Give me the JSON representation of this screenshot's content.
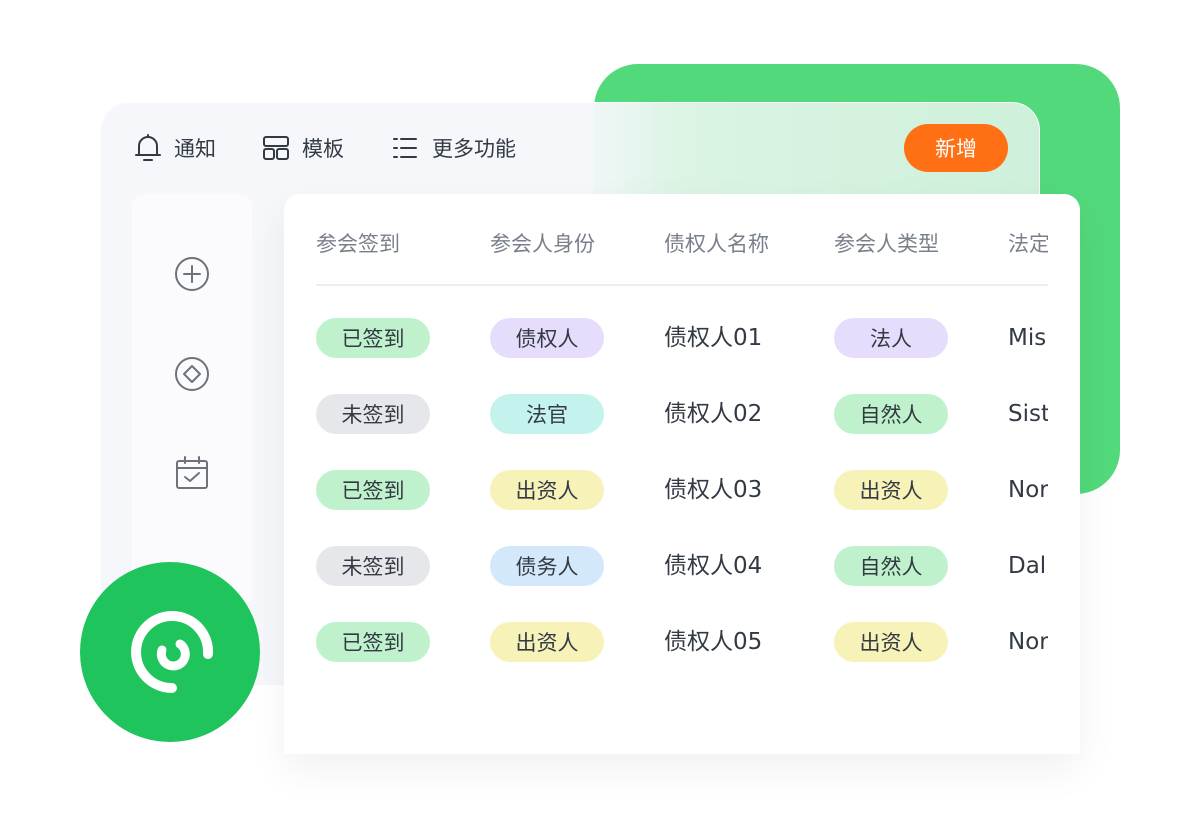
{
  "toolbar": {
    "notify_label": "通知",
    "template_label": "模板",
    "more_label": "更多功能",
    "add_label": "新增",
    "add_color": "#ff7015"
  },
  "sidebar": {
    "icons": [
      "plus-circle-icon",
      "diamond-icon",
      "calendar-check-icon"
    ]
  },
  "table": {
    "headers": [
      "参会签到",
      "参会人身份",
      "债权人名称",
      "参会人类型",
      "法定"
    ],
    "rows": [
      {
        "checkin": "已签到",
        "identity": "债权人",
        "name": "债权人01",
        "type": "法人",
        "legal": "Mis"
      },
      {
        "checkin": "未签到",
        "identity": "法官",
        "name": "债权人02",
        "type": "自然人",
        "legal": "Sist"
      },
      {
        "checkin": "已签到",
        "identity": "出资人",
        "name": "债权人03",
        "type": "出资人",
        "legal": "Nor"
      },
      {
        "checkin": "未签到",
        "identity": "债务人",
        "name": "债权人04",
        "type": "自然人",
        "legal": "Dalı"
      },
      {
        "checkin": "已签到",
        "identity": "出资人",
        "name": "债权人05",
        "type": "出资人",
        "legal": "Nor"
      }
    ]
  },
  "colors": {
    "accent_green": "#52d97b",
    "logo_green": "#1fc45c"
  },
  "logo": {
    "icon": "spiral-logo-icon"
  }
}
